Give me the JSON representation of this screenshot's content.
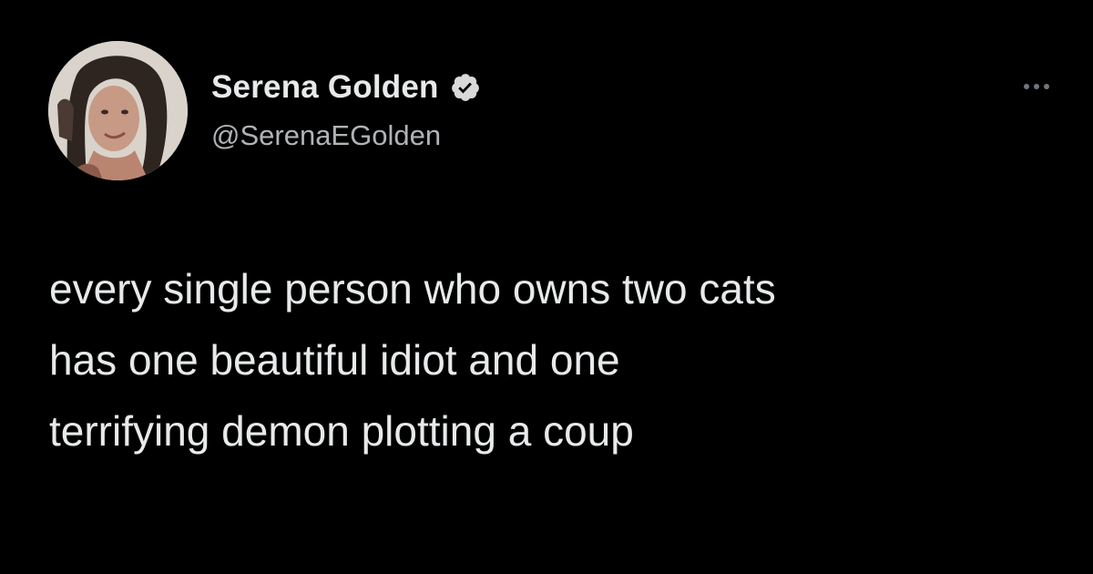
{
  "tweet": {
    "author": {
      "display_name": "Serena Golden",
      "handle": "@SerenaEGolden",
      "verified": true,
      "verified_icon": "verified-badge-icon",
      "avatar": "profile-photo"
    },
    "more_icon": "more-options-icon",
    "text_lines": [
      "every single person who owns two cats",
      "has one beautiful idiot and one",
      "terrifying demon plotting a coup"
    ]
  },
  "colors": {
    "background": "#000000",
    "primary_text": "#e7e9ea",
    "secondary_text": "#b0b3b6",
    "muted_icon": "#71767b"
  }
}
